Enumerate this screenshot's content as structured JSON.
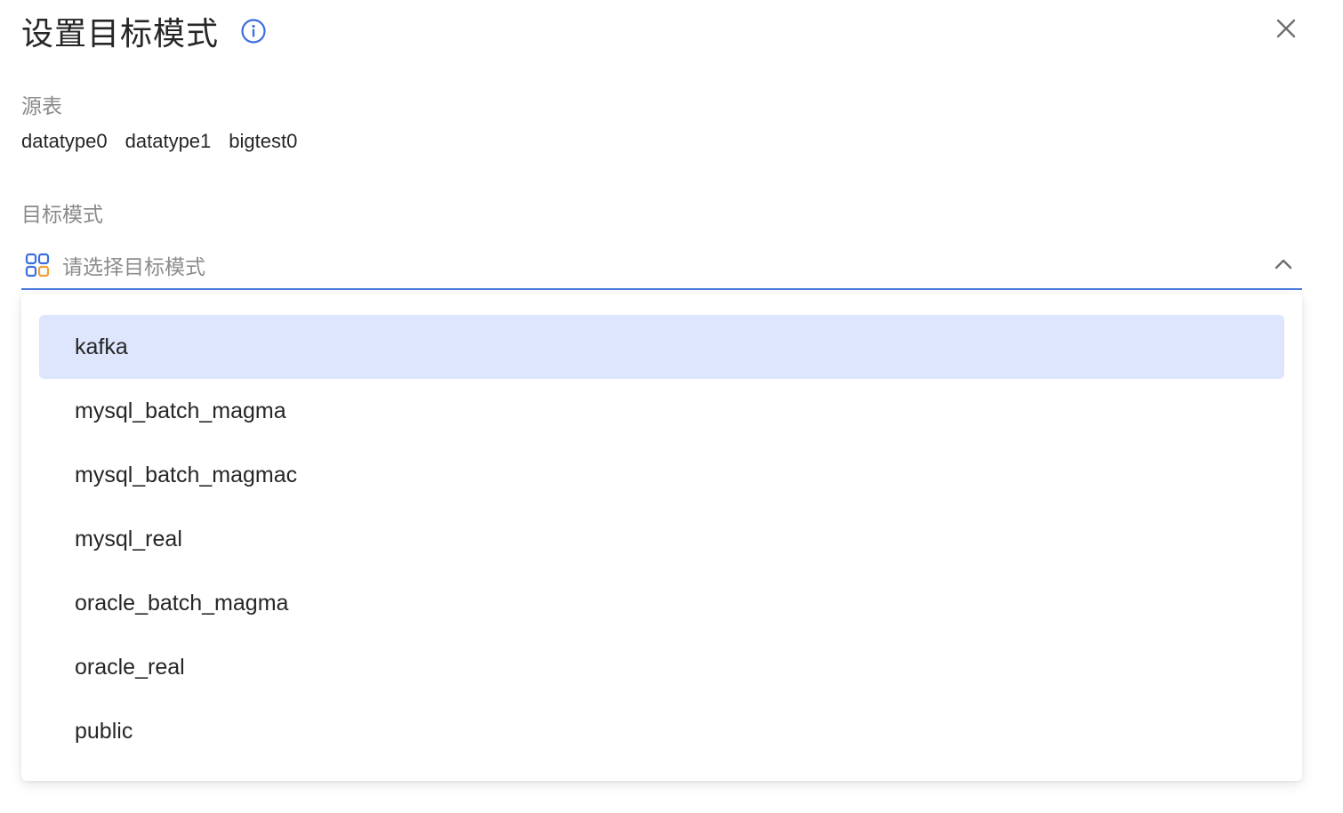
{
  "dialog": {
    "title": "设置目标模式",
    "icons": {
      "info": "info-icon",
      "close": "close-icon"
    }
  },
  "source": {
    "label": "源表",
    "tables": [
      "datatype0",
      "datatype1",
      "bigtest0"
    ]
  },
  "target": {
    "label": "目标模式",
    "placeholder": "请选择目标模式",
    "icons": {
      "field": "grid-icon",
      "toggle": "chevron-up-icon"
    },
    "options": [
      "kafka",
      "mysql_batch_magma",
      "mysql_batch_magmac",
      "mysql_real",
      "oracle_batch_magma",
      "oracle_real",
      "public"
    ],
    "highlighted": "kafka"
  },
  "colors": {
    "accent": "#4a7bdc",
    "highlight": "#dde6fd",
    "grid_orange": "#f0a030"
  }
}
